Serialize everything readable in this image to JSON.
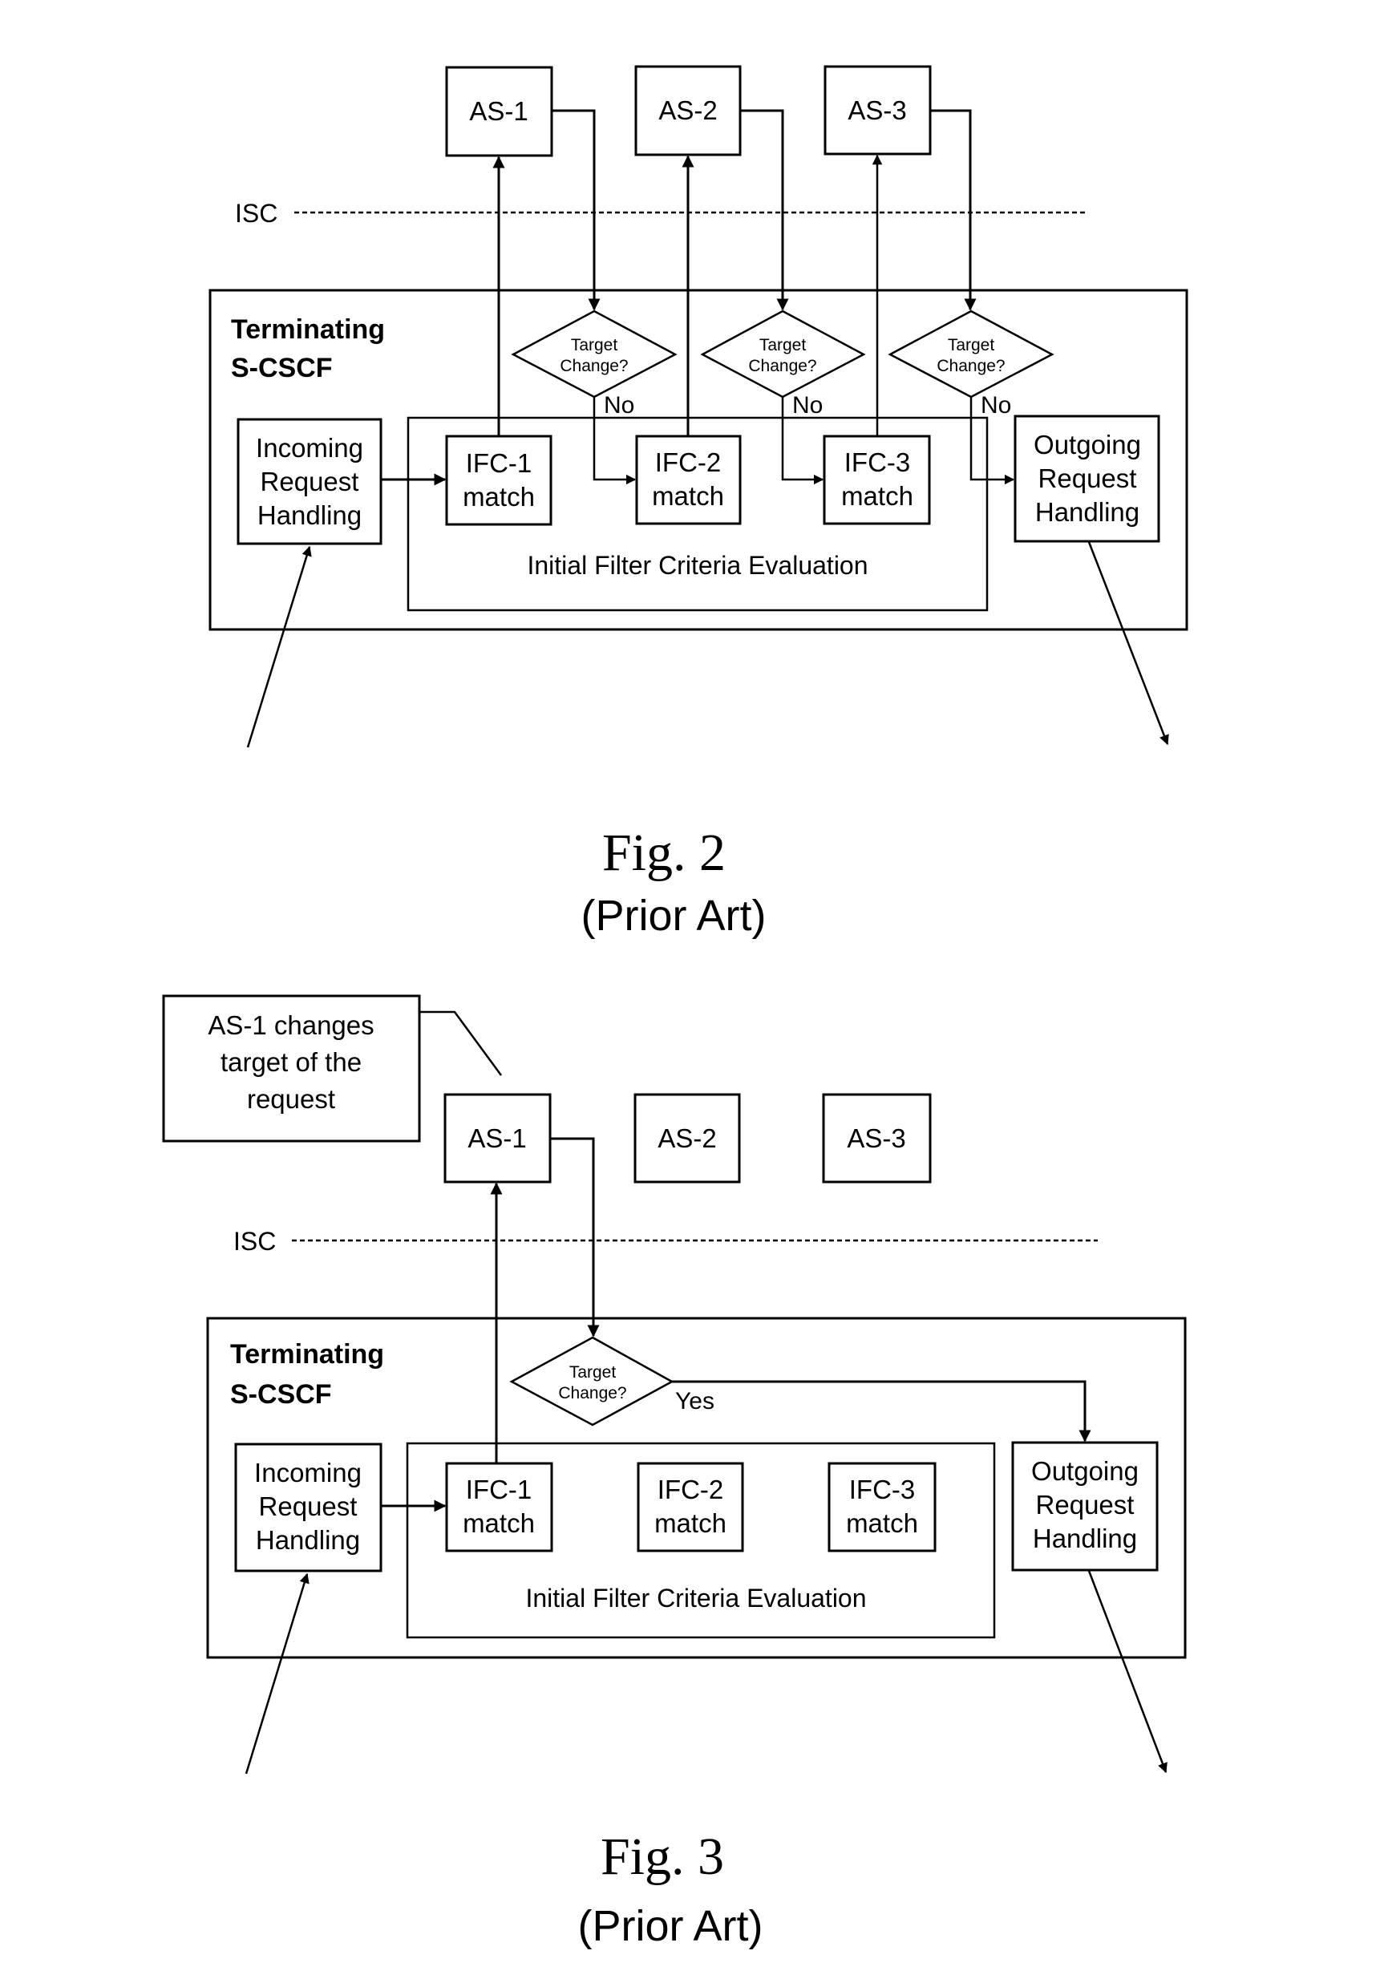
{
  "figures": [
    {
      "caption": "Fig. 2",
      "subcaption": "(Prior Art)",
      "interface_label": "ISC",
      "container_label_line1": "Terminating",
      "container_label_line2": "S-CSCF",
      "application_servers": [
        "AS-1",
        "AS-2",
        "AS-3"
      ],
      "incoming": [
        "Incoming",
        "Request",
        "Handling"
      ],
      "outgoing": [
        "Outgoing",
        "Request",
        "Handling"
      ],
      "evaluation_label": "Initial Filter Criteria Evaluation",
      "ifc": [
        {
          "line1": "IFC-1",
          "line2": "match"
        },
        {
          "line1": "IFC-2",
          "line2": "match"
        },
        {
          "line1": "IFC-3",
          "line2": "match"
        }
      ],
      "decisions": [
        {
          "line1": "Target",
          "line2": "Change?",
          "branch": "No"
        },
        {
          "line1": "Target",
          "line2": "Change?",
          "branch": "No"
        },
        {
          "line1": "Target",
          "line2": "Change?",
          "branch": "No"
        }
      ]
    },
    {
      "caption": "Fig. 3",
      "subcaption": "(Prior Art)",
      "interface_label": "ISC",
      "container_label_line1": "Terminating",
      "container_label_line2": "S-CSCF",
      "callout": [
        "AS-1 changes",
        "target of the",
        "request"
      ],
      "application_servers": [
        "AS-1",
        "AS-2",
        "AS-3"
      ],
      "incoming": [
        "Incoming",
        "Request",
        "Handling"
      ],
      "outgoing": [
        "Outgoing",
        "Request",
        "Handling"
      ],
      "evaluation_label": "Initial Filter Criteria Evaluation",
      "ifc": [
        {
          "line1": "IFC-1",
          "line2": "match"
        },
        {
          "line1": "IFC-2",
          "line2": "match"
        },
        {
          "line1": "IFC-3",
          "line2": "match"
        }
      ],
      "decisions": [
        {
          "line1": "Target",
          "line2": "Change?",
          "branch": "Yes"
        }
      ]
    }
  ]
}
